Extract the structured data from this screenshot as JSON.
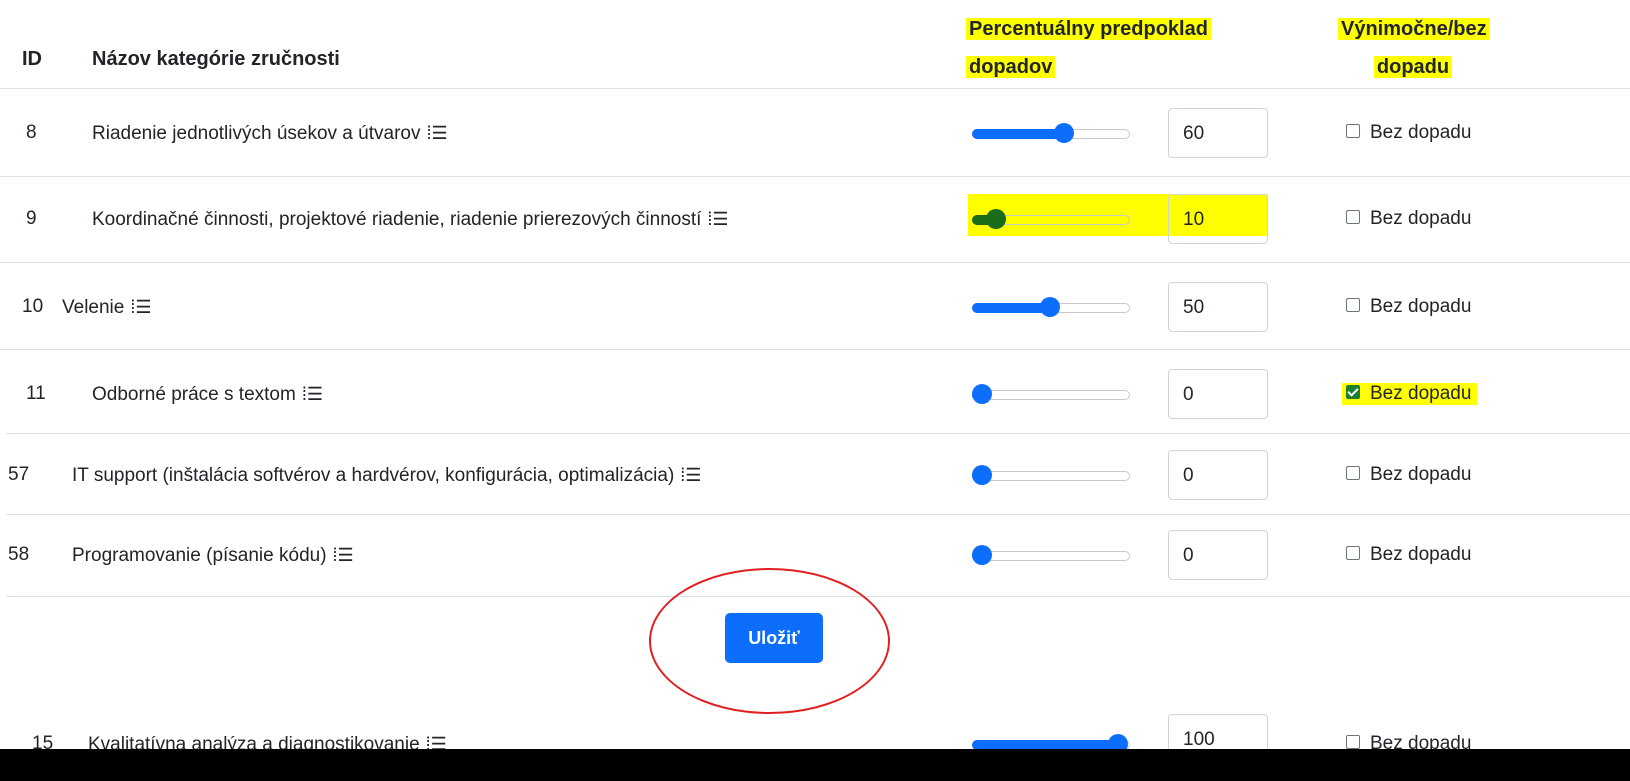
{
  "table": {
    "headers": {
      "id": "ID",
      "name": "Názov kategórie zručnosti",
      "percent_line1": "Percentuálny predpoklad",
      "percent_line2": "dopadov",
      "exception_line1": "Výnimočne/bez",
      "exception_line2": "dopadu"
    },
    "rows": [
      {
        "id": "8",
        "name": "Riadenie jednotlivých úsekov a útvarov",
        "value": "60",
        "level": 60,
        "checked": false,
        "checkbox_label": "Bez dopadu"
      },
      {
        "id": "9",
        "name": "Koordinačné činnosti, projektové riadenie, riadenie prierezových činností",
        "value": "10",
        "level": 10,
        "checked": false,
        "checkbox_label": "Bez dopadu"
      },
      {
        "id": "10",
        "name": "Velenie",
        "value": "50",
        "level": 50,
        "checked": false,
        "checkbox_label": "Bez dopadu"
      },
      {
        "id": "11",
        "name": "Odborné práce s textom",
        "value": "0",
        "level": 0,
        "checked": true,
        "checkbox_label": "Bez dopadu"
      },
      {
        "id": "57",
        "name": "IT support (inštalácia softvérov a hardvérov, konfigurácia, optimalizácia)",
        "value": "0",
        "level": 0,
        "checked": false,
        "checkbox_label": "Bez dopadu"
      },
      {
        "id": "58",
        "name": "Programovanie (písanie kódu)",
        "value": "0",
        "level": 0,
        "checked": false,
        "checkbox_label": "Bez dopadu"
      },
      {
        "id": "15",
        "name": "Kvalitatívna analýza a diagnostikovanie",
        "value": "100",
        "level": 100,
        "checked": false,
        "checkbox_label": "Bez dopadu"
      }
    ],
    "list_icon": "list-icon",
    "list_glyph": "⁞☰"
  },
  "save_button": {
    "label": "Uložiť"
  },
  "colors": {
    "accent": "#0d6efd",
    "highlight": "#ffff00",
    "annotation_circle": "#e02020",
    "checked_box": "#1a7f2e"
  }
}
